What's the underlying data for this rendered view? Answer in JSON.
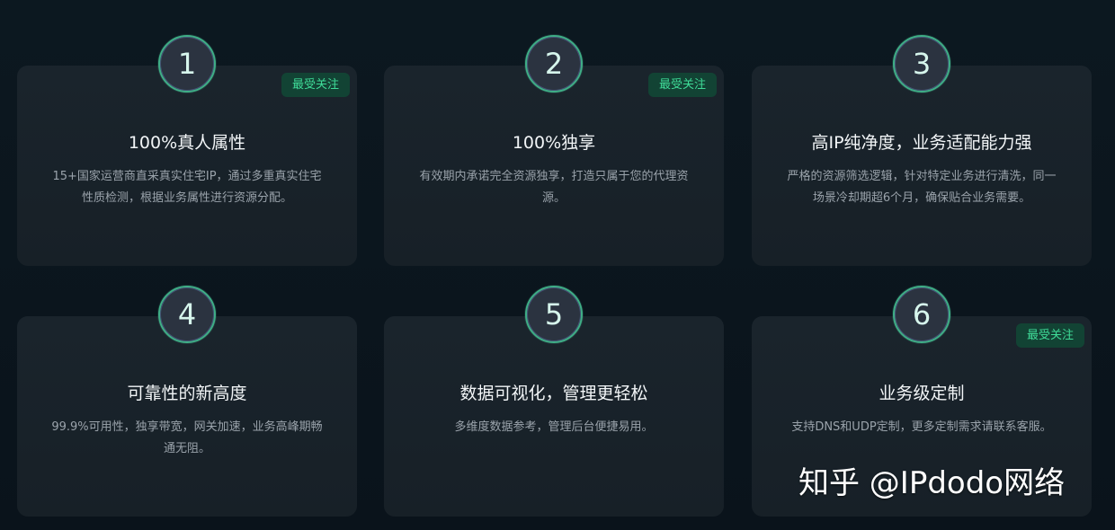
{
  "features": [
    {
      "number": "1",
      "badge": "最受关注",
      "title": "100%真人属性",
      "desc": "15+国家运营商直采真实住宅IP，通过多重真实住宅性质检测，根据业务属性进行资源分配。"
    },
    {
      "number": "2",
      "badge": "最受关注",
      "title": "100%独享",
      "desc": "有效期内承诺完全资源独享，打造只属于您的代理资源。"
    },
    {
      "number": "3",
      "title": "高IP纯净度，业务适配能力强",
      "desc": "严格的资源筛选逻辑，针对特定业务进行清洗，同一场景冷却期超6个月，确保贴合业务需要。"
    },
    {
      "number": "4",
      "title": "可靠性的新高度",
      "desc": "99.9%可用性，独享带宽，网关加速，业务高峰期畅通无阻。"
    },
    {
      "number": "5",
      "title": "数据可视化，管理更轻松",
      "desc": "多维度数据参考，管理后台便捷易用。"
    },
    {
      "number": "6",
      "badge": "最受关注",
      "title": "业务级定制",
      "desc": "支持DNS和UDP定制，更多定制需求请联系客服。"
    }
  ],
  "watermark": "知乎 @IPdodo网络"
}
